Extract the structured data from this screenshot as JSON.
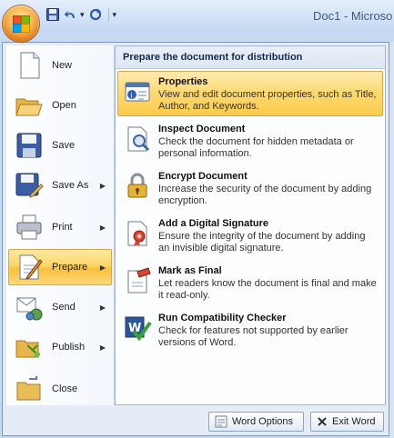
{
  "window": {
    "title": "Doc1 - Microso"
  },
  "quick_access": {
    "save_icon": "floppy-disk-icon",
    "undo_icon": "undo-icon",
    "redo_icon": "redo-icon",
    "dropdown_label": "▾"
  },
  "menu": {
    "left_items": [
      {
        "label": "New",
        "icon": "new-document-icon",
        "has_arrow": false
      },
      {
        "label": "Open",
        "icon": "open-folder-icon",
        "has_arrow": false
      },
      {
        "label": "Save",
        "icon": "floppy-disk-icon",
        "has_arrow": false
      },
      {
        "label": "Save As",
        "icon": "save-as-icon",
        "has_arrow": true
      },
      {
        "label": "Print",
        "icon": "printer-icon",
        "has_arrow": true
      },
      {
        "label": "Prepare",
        "icon": "prepare-document-icon",
        "has_arrow": true,
        "active": true
      },
      {
        "label": "Send",
        "icon": "send-icon",
        "has_arrow": true
      },
      {
        "label": "Publish",
        "icon": "publish-icon",
        "has_arrow": true
      },
      {
        "label": "Close",
        "icon": "close-folder-icon",
        "has_arrow": false
      }
    ],
    "submenu": {
      "header": "Prepare the document for distribution",
      "items": [
        {
          "title": "Properties",
          "description": "View and edit document properties, such as Title, Author, and Keywords.",
          "icon": "properties-icon",
          "active": true
        },
        {
          "title": "Inspect Document",
          "description": "Check the document for hidden metadata or personal information.",
          "icon": "inspect-document-icon"
        },
        {
          "title": "Encrypt Document",
          "description": "Increase the security of the document by adding encryption.",
          "icon": "encrypt-lock-icon"
        },
        {
          "title": "Add a Digital Signature",
          "description": "Ensure the integrity of the document by adding an invisible digital signature.",
          "icon": "digital-signature-icon"
        },
        {
          "title": "Mark as Final",
          "description": "Let readers know the document is final and make it read-only.",
          "icon": "mark-final-icon"
        },
        {
          "title": "Run Compatibility Checker",
          "description": "Check for features not supported by earlier versions of Word.",
          "icon": "compatibility-checker-icon"
        }
      ]
    },
    "footer": {
      "word_options_label": "Word Options",
      "exit_label": "Exit Word"
    }
  },
  "colors": {
    "highlight": "#fcd666",
    "frame": "#7b96c0",
    "title_text": "#3e5a7f"
  }
}
